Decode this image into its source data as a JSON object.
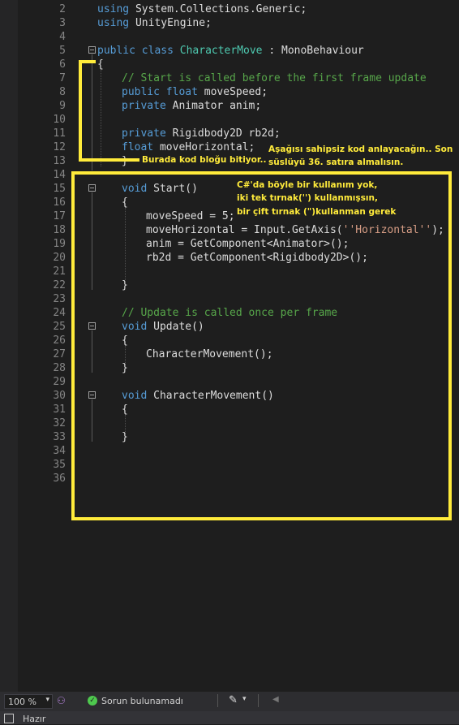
{
  "editor": {
    "lines": [
      {
        "n": "2"
      },
      {
        "n": "3"
      },
      {
        "n": "4"
      },
      {
        "n": "5"
      },
      {
        "n": "6"
      },
      {
        "n": "7"
      },
      {
        "n": "8"
      },
      {
        "n": "9"
      },
      {
        "n": "10"
      },
      {
        "n": "11"
      },
      {
        "n": "12"
      },
      {
        "n": "13"
      },
      {
        "n": "14"
      },
      {
        "n": "15"
      },
      {
        "n": "16"
      },
      {
        "n": "17"
      },
      {
        "n": "18"
      },
      {
        "n": "19"
      },
      {
        "n": "20"
      },
      {
        "n": "21"
      },
      {
        "n": "22"
      },
      {
        "n": "23"
      },
      {
        "n": "24"
      },
      {
        "n": "25"
      },
      {
        "n": "26"
      },
      {
        "n": "27"
      },
      {
        "n": "28"
      },
      {
        "n": "29"
      },
      {
        "n": "30"
      },
      {
        "n": "31"
      },
      {
        "n": "32"
      },
      {
        "n": "33"
      },
      {
        "n": "34"
      },
      {
        "n": "35"
      },
      {
        "n": "36"
      }
    ],
    "code": {
      "l2": {
        "kw": "using",
        "rest": " System.Collections.Generic;"
      },
      "l3": {
        "kw": "using",
        "rest": " UnityEngine;"
      },
      "l5": {
        "kw1": "public",
        "kw2": "class",
        "type": "CharacterMove",
        "rest": " : MonoBehaviour"
      },
      "l6": "{",
      "l7": "// Start is called before the first frame update",
      "l8": {
        "kw1": "public",
        "kw2": "float",
        "rest": " moveSpeed;"
      },
      "l9": {
        "kw": "private",
        "rest": " Animator anim;"
      },
      "l11": {
        "kw": "private",
        "rest": " Rigidbody2D rb2d;"
      },
      "l12": {
        "kw": "float",
        "rest": " moveHorizontal;"
      },
      "l13": "}",
      "l15": {
        "kw": "void",
        "rest": " Start()"
      },
      "l16": "{",
      "l17": "moveSpeed = 5;",
      "l18": {
        "pre": "moveHorizontal = Input.GetAxis(",
        "str": "''Horizontal''",
        "post": ");"
      },
      "l19": "anim = GetComponent<Animator>();",
      "l20": "rb2d = GetComponent<Rigidbody2D>();",
      "l22": "}",
      "l24": "// Update is called once per frame",
      "l25": {
        "kw": "void",
        "rest": " Update()"
      },
      "l26": "{",
      "l27": "CharacterMovement();",
      "l28": "}",
      "l30": {
        "kw": "void",
        "rest": " CharacterMovement()"
      },
      "l31": "{",
      "l33": "}"
    }
  },
  "annotations": {
    "block_end": "Burada kod bloğu bitiyor..",
    "remove_code": [
      "Aşağısı sahipsiz kod anlayacağın.. Son",
      "süslüyü 36. satıra almalısın."
    ],
    "quote_hint": [
      "C#'da böyle bir kullanım yok,",
      "iki tek tırnak('') kullanmışsın,",
      "bir çift tırnak (\")kullanman gerek"
    ]
  },
  "colors": {
    "annotation": "#ffeb3b",
    "keyword": "#569cd6",
    "type": "#4ec9b0",
    "comment": "#57a64a",
    "string": "#d69d85"
  },
  "status": {
    "zoom": "100 %",
    "issues": "Sorun bulunamadı",
    "ready": "Hazır"
  },
  "icons": [
    "dropdown-icon",
    "copilot-icon",
    "check-circle-icon",
    "brush-icon",
    "chevron-left-icon"
  ]
}
